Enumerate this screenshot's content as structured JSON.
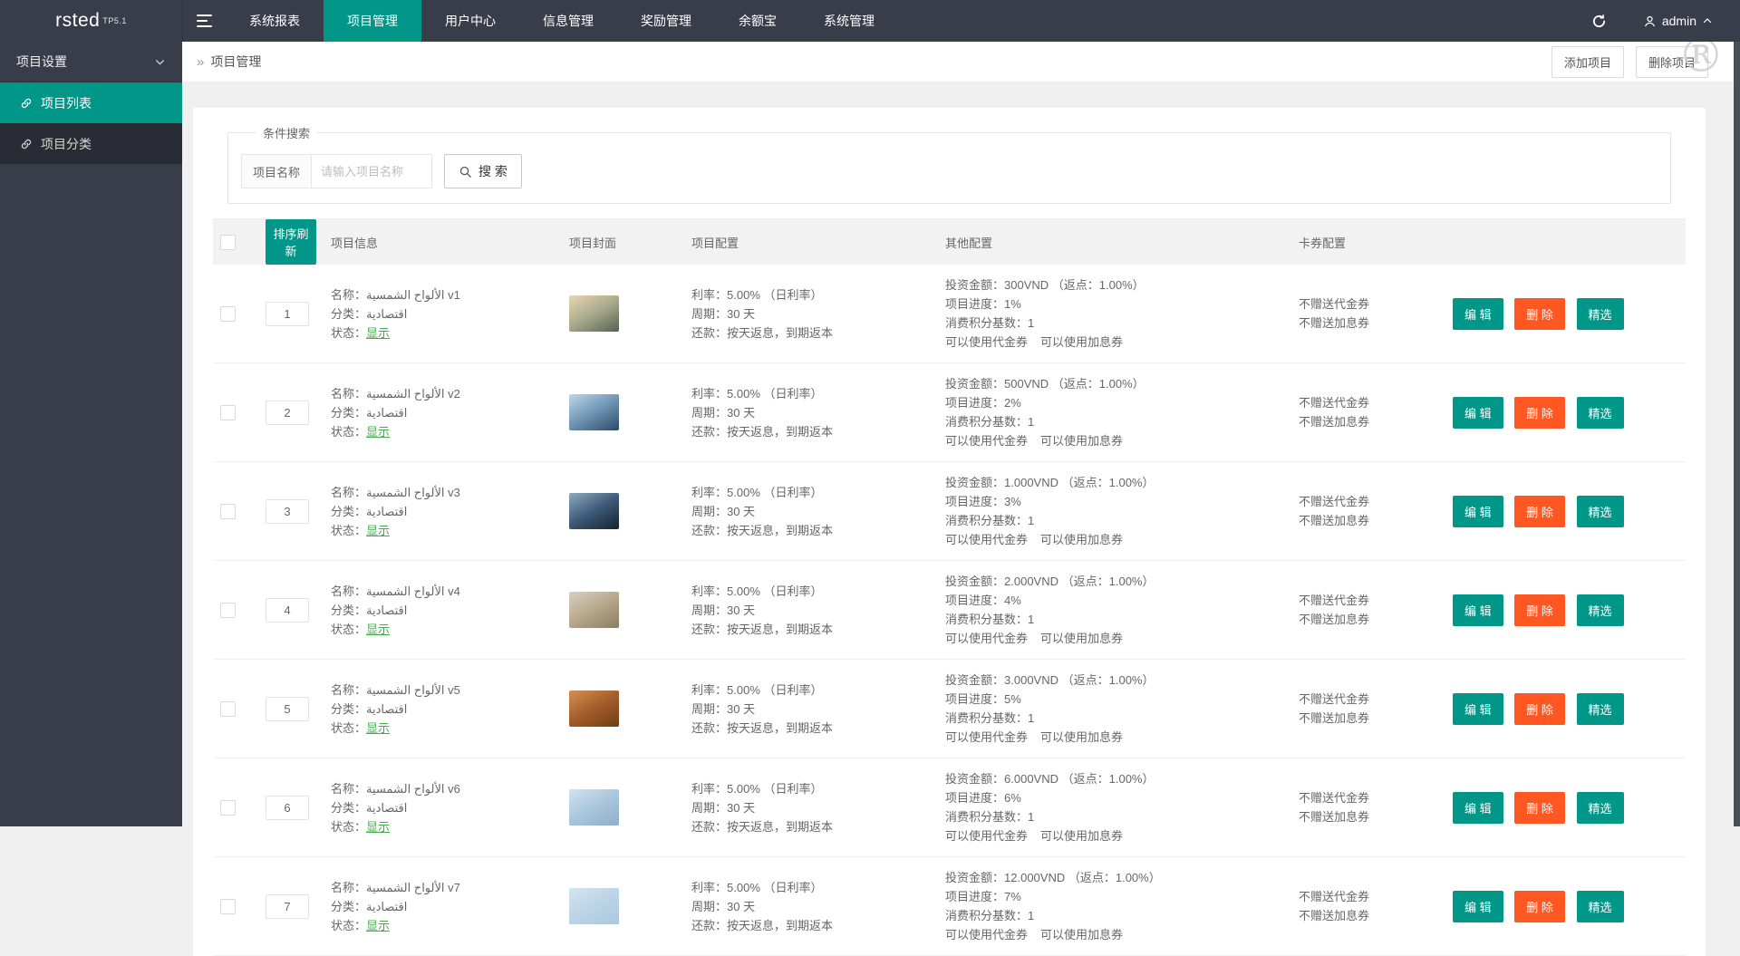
{
  "colors": {
    "teal": "#009688",
    "orange": "#FF5722",
    "topbar_dark": "#393D49",
    "status_green": "#3fae49"
  },
  "topbar": {
    "logo": "rsted",
    "logo_sup": "TP5.1",
    "menu": [
      "系统报表",
      "项目管理",
      "用户中心",
      "信息管理",
      "奖励管理",
      "余额宝",
      "系统管理"
    ],
    "active": "项目管理",
    "user": "admin",
    "icons": [
      "hamburger-icon",
      "refresh-icon",
      "user-icon",
      "chevron-up-icon"
    ]
  },
  "sidebar": {
    "group": "项目设置",
    "items": [
      "项目列表",
      "项目分类"
    ],
    "active": "项目列表",
    "icons": [
      "chevron-down-icon",
      "link-icon"
    ]
  },
  "page": {
    "breadcrumb_icon": "»",
    "breadcrumb": "项目管理",
    "add_button": "添加项目",
    "delete_button": "删除项目",
    "watermark": "®"
  },
  "search": {
    "legend": "条件搜索",
    "field_label": "项目名称",
    "placeholder": "请输入项目名称",
    "button": "搜 索",
    "icon": "magnifier-icon"
  },
  "table": {
    "headers": {
      "sort": "排序刷新",
      "info": "项目信息",
      "cover": "项目封面",
      "config": "项目配置",
      "other": "其他配置",
      "coupon": "卡券配置"
    },
    "labels": {
      "name": "名称：",
      "category": "分类：",
      "status": "状态：",
      "rate": "利率：",
      "period": "周期：",
      "repay": "还款：",
      "amount": "投资金额：",
      "progress": "项目进度：",
      "points": "消费积分基数："
    },
    "common": {
      "category": "اقتصادية",
      "status": "显示",
      "rate": "5.00%",
      "rate_note": "（日利率）",
      "period": "30 天",
      "repay": "按天返息，到期返本",
      "rebate_note": "（返点：1.00%）",
      "points": "1",
      "can_voucher": "可以使用代金券",
      "can_interest": "可以使用加息券",
      "no_voucher": "不赠送代金券",
      "no_interest": "不赠送加息券"
    },
    "rows": [
      {
        "order": "1",
        "name": "الألواح الشمسية v1",
        "amount": "300VND",
        "progress": "1%",
        "cover": [
          "#e9d6b4",
          "#a8a98c",
          "#53624f"
        ]
      },
      {
        "order": "2",
        "name": "الألواح الشمسية v2",
        "amount": "500VND",
        "progress": "2%",
        "cover": [
          "#bdd7ea",
          "#6f94b4",
          "#2e4a66"
        ]
      },
      {
        "order": "3",
        "name": "الألواح الشمسية v3",
        "amount": "1.000VND",
        "progress": "3%",
        "cover": [
          "#8fa9bf",
          "#3c5a78",
          "#17222f"
        ]
      },
      {
        "order": "4",
        "name": "الألواح الشمسية v4",
        "amount": "2.000VND",
        "progress": "4%",
        "cover": [
          "#d9cfc0",
          "#b7a78c",
          "#8a7c62"
        ]
      },
      {
        "order": "5",
        "name": "الألواح الشمسية v5",
        "amount": "3.000VND",
        "progress": "5%",
        "cover": [
          "#d49153",
          "#a35c2a",
          "#6f3d18"
        ]
      },
      {
        "order": "6",
        "name": "الألواح الشمسية v6",
        "amount": "6.000VND",
        "progress": "6%",
        "cover": [
          "#d3e2ee",
          "#a9c6dc",
          "#8fb0c9"
        ]
      },
      {
        "order": "7",
        "name": "الألواح الشمسية v7",
        "amount": "12.000VND",
        "progress": "7%",
        "cover": [
          "#d3e5f2",
          "#bcd4e6",
          "#a9c8de"
        ]
      }
    ]
  },
  "actions": {
    "edit": "编 辑",
    "delete": "删 除",
    "featured": "精选"
  }
}
